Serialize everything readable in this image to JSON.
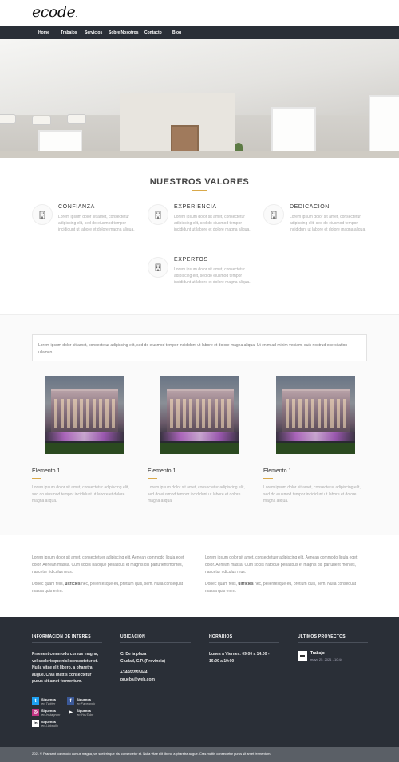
{
  "brand": {
    "logo": "ecode"
  },
  "nav": [
    "Home",
    "Trabajos",
    "Servicios",
    "Sobre Nosotros",
    "Contacto",
    "Blog"
  ],
  "values": {
    "title": "NUESTROS VALORES",
    "items": [
      {
        "title": "CONFIANZA",
        "text": "Lorem ipsum dolor sit amet, consectetur adipiscing elit, sed do eiusmod tempor incididunt ut labore et dolore magna aliqua."
      },
      {
        "title": "EXPERIENCIA",
        "text": "Lorem ipsum dolor sit amet, consectetur adipiscing elit, sed do eiusmod tempor incididunt ut labore et dolore magna aliqua."
      },
      {
        "title": "DEDICACIÓN",
        "text": "Lorem ipsum dolor sit amet, consectetur adipiscing elit, sed do eiusmod tempor incididunt ut labore et dolore magna aliqua."
      },
      {
        "title": "EXPERTOS",
        "text": "Lorem ipsum dolor sit amet, consectetur adipiscing elit, sed do eiusmod tempor incididunt ut labore et dolore magna aliqua."
      }
    ]
  },
  "notice": "Lorem ipsum dolor sit amet, consectetur adipiscing elit, sed do eiusmod tempor incididunt ut labore et dolore magna aliqua. Ut enim ad minim veniam, quis nostrud exercitation ullamco.",
  "elements": [
    {
      "title": "Elemento 1",
      "text": "Lorem ipsum dolor sit amet, consectetur adipiscing elit, sed do eiusmod tempor incididunt ut labore et dolore magna aliqua."
    },
    {
      "title": "Elemento 1",
      "text": "Lorem ipsum dolor sit amet, consectetur adipiscing elit, sed do eiusmod tempor incididunt ut labore et dolore magna aliqua."
    },
    {
      "title": "Elemento 1",
      "text": "Lorem ipsum dolor sit amet, consectetur adipiscing elit, sed do eiusmod tempor incididunt ut labore et dolore magna aliqua."
    }
  ],
  "columns": [
    {
      "p1": "Lorem ipsum dolor sit amet, consectetuer adipiscing elit. Aenean commodo ligula eget dolor. Aenean massa. Cum sociis natoque penatibus et magnis dis parturient montes, nascetur ridiculus mus.",
      "p2_pre": "Donec quam felis, ",
      "p2_bold": "ultricies",
      "p2_post": " nec, pellentesque eu, pretium quis, sem. Nulla consequat massa quis enim."
    },
    {
      "p1": "Lorem ipsum dolor sit amet, consectetuer adipiscing elit. Aenean commodo ligula eget dolor. Aenean massa. Cum sociis natoque penatibus et magnis dis parturient montes, nascetur ridiculus mus.",
      "p2_pre": "Donec quam felis, ",
      "p2_bold": "ultricies",
      "p2_post": " nec, pellentesque eu, pretium quis, sem. Nulla consequat massa quis enim."
    }
  ],
  "footer": {
    "info": {
      "title": "INFORMACIÓN DE INTERÉS",
      "text": "Praesent commodo cursus magna, vel scelerisque nisl consectetur et. Nulla vitae elit libero, a pharetra augue. Cras mattis consectetur purus sit amet fermentum."
    },
    "location": {
      "title": "UBICACIÓN",
      "line1": "C/ De la plaza",
      "line2": "Ciudad, C.P. (Provincia)",
      "phone": "+34666555444",
      "email": "prueba@web.com"
    },
    "hours": {
      "title": "HORARIOS",
      "text": "Lunes a Viernes: 09:00 a 14:00 - 16:00 a 19:00"
    },
    "projects": {
      "title": "ÚLTIMOS PROYECTOS",
      "item_title": "Trabajo",
      "item_date": "mayo 25, 2021 - 10:44"
    },
    "social": [
      {
        "label": "Síguenos",
        "network": "en Twitter",
        "icon": "twitter-icon",
        "color": "#1da1f2",
        "glyph": "t"
      },
      {
        "label": "Síguenos",
        "network": "en Facebook",
        "icon": "facebook-icon",
        "color": "#3b5998",
        "glyph": "f"
      },
      {
        "label": "Síguenos",
        "network": "en Instagram",
        "icon": "instagram-icon",
        "color": "#c13584",
        "glyph": "◎"
      },
      {
        "label": "Síguenos",
        "network": "en YouTube",
        "icon": "youtube-icon",
        "color": "#2a2f37",
        "glyph": "▶"
      },
      {
        "label": "Síguenos",
        "network": "en LinkedIn",
        "icon": "linkedin-icon",
        "color": "#2a2f37",
        "glyph": "in"
      }
    ]
  },
  "copyright": "2021 © Praesent commodo cursus magna, vel scelerisque nisl consectetur et. Nulla vitae elit libero, a pharetra augue. Cras mattis consectetur purus sit amet fermentum.",
  "colors": {
    "accent": "#d9a94a",
    "dark": "#2a2f37",
    "bottom": "#5a5f66"
  }
}
